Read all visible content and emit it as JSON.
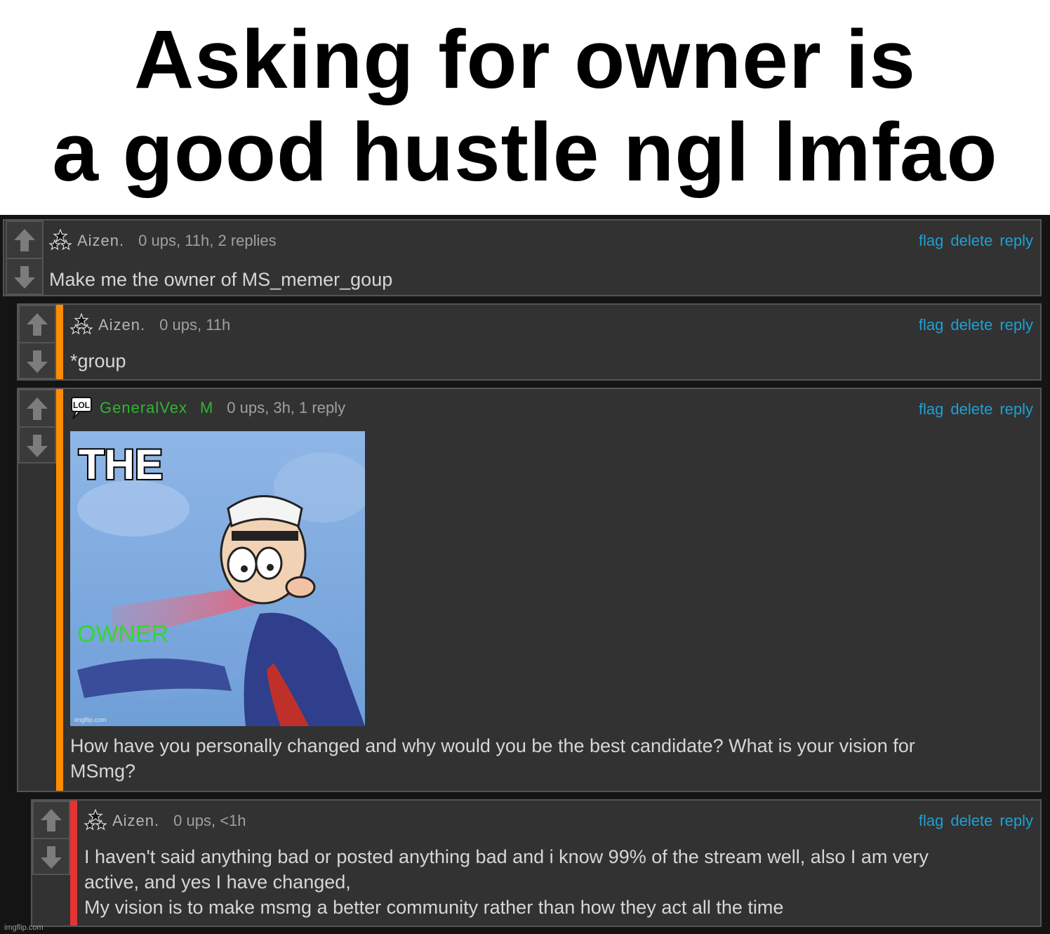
{
  "caption": {
    "line1": "Asking for owner is",
    "line2": "a good hustle ngl lmfao"
  },
  "comments": [
    {
      "username": "Aizen.",
      "meta": "0 ups, 11h, 2 replies",
      "actions": {
        "flag": "flag",
        "delete": "delete",
        "reply": "reply"
      },
      "text": "Make me the owner of MS_memer_goup",
      "icon": "three-stars-icon"
    },
    {
      "username": "Aizen.",
      "meta": "0 ups, 11h",
      "actions": {
        "flag": "flag",
        "delete": "delete",
        "reply": "reply"
      },
      "text": "*group",
      "icon": "three-stars-icon"
    },
    {
      "username": "GeneralVex",
      "mod_badge": "M",
      "meta": "0 ups, 3h, 1 reply",
      "actions": {
        "flag": "flag",
        "delete": "delete",
        "reply": "reply"
      },
      "image": {
        "top_text": "THE",
        "caption": "OWNER",
        "watermark": "imgflip.com"
      },
      "text_line1": "How have you personally changed and why would you be the best candidate? What is your vision for",
      "text_line2": "MSmg?",
      "icon": "lol-speech-bubble-icon",
      "icon_text": "LOL"
    },
    {
      "username": "Aizen.",
      "meta": "0 ups, <1h",
      "actions": {
        "flag": "flag",
        "delete": "delete",
        "reply": "reply"
      },
      "text_line1": "I haven't said anything bad or posted anything bad and i know 99% of the stream well, also I am very",
      "text_line2": "active, and yes I have changed,",
      "text_line3": "My vision is to make msmg a better community rather than how they act all the time",
      "icon": "three-stars-icon"
    }
  ],
  "footer": {
    "watermark": "imgflip.com"
  },
  "colors": {
    "accent_link": "#1ea0d2",
    "reply_bar_level1": "#ff8c00",
    "reply_bar_level2": "#e53333",
    "mod_green": "#32b432"
  }
}
